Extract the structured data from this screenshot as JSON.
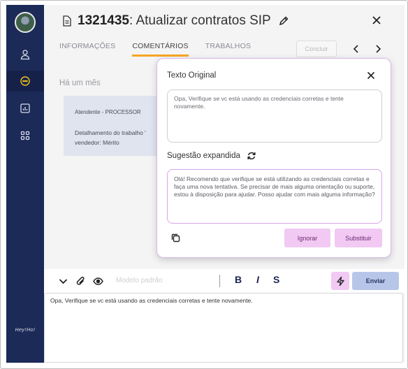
{
  "ticket": {
    "number": "1321435",
    "title": ": Atualizar contratos SIP"
  },
  "tabs": [
    {
      "label": "INFORMAÇÕES",
      "active": false
    },
    {
      "label": "COMENTÁRIOS",
      "active": true
    },
    {
      "label": "TRABALHOS",
      "active": false
    }
  ],
  "actions": {
    "conclude_label": "Concluir"
  },
  "comments": {
    "time_ago": "Há um mês",
    "card": {
      "author": "Atendente - PROCESSOR",
      "line1": "Detalhamento do trabalho '",
      "line2": "vendedor: Mérito"
    }
  },
  "popup": {
    "original_title": "Texto Original",
    "original_text": "Opa, Verifique se vc está usando as credenciais corretas e tente novamente.",
    "suggestion_title": "Sugestão expandida",
    "suggestion_text": "Olá! Recomendo que verifique se está utilizando as credenciais corretas e faça uma nova tentativa. Se precisar de mais alguma orientação ou suporte, estou à disposição para ajudar. Posso ajudar com mais alguma informação?",
    "ignore_label": "Ignorar",
    "replace_label": "Substituir"
  },
  "composer": {
    "template_placeholder": "Modelo padrão",
    "bold": "B",
    "italic": "I",
    "strike": "S",
    "send_label": "Enviar",
    "text": "Opa, Verifique se vc está usando as credenciais corretas e tente novamente."
  },
  "sidebar": {
    "logo_text": "Hey!Ho!"
  },
  "colors": {
    "sidebar": "#1b2a57",
    "accent_tab": "#f5a623",
    "ai_pink": "#f1c9f3",
    "send_blue": "#b7c6e8",
    "active_icon": "#f5c518"
  },
  "icons": [
    "document-icon",
    "pencil-icon",
    "close-icon",
    "chevron-left-icon",
    "chevron-right-icon",
    "user-icon",
    "chat-icon",
    "chart-icon",
    "grid-icon",
    "refresh-icon",
    "copy-icon",
    "chevron-down-icon",
    "paperclip-icon",
    "eye-icon",
    "lightning-icon"
  ]
}
